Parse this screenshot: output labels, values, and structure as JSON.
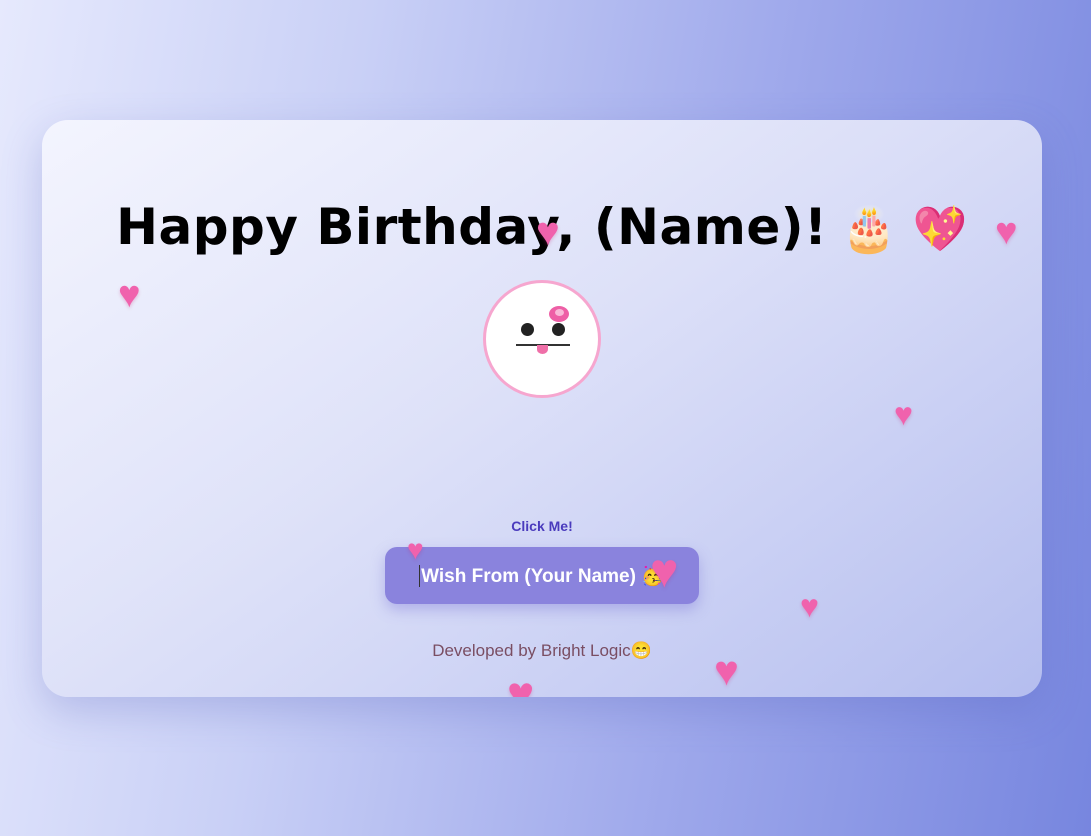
{
  "card": {
    "title": "Happy Birthday, (Name)!",
    "title_emojis": "🎂 💖",
    "click_label": "Click Me!",
    "wish_button_label": "Wish From (Your Name) 🥳",
    "credit": "Developed by Bright Logic😁"
  },
  "decor": {
    "heart_glyph": "♥",
    "heart_color": "#f062ad",
    "accent_color": "#8a83dd"
  }
}
